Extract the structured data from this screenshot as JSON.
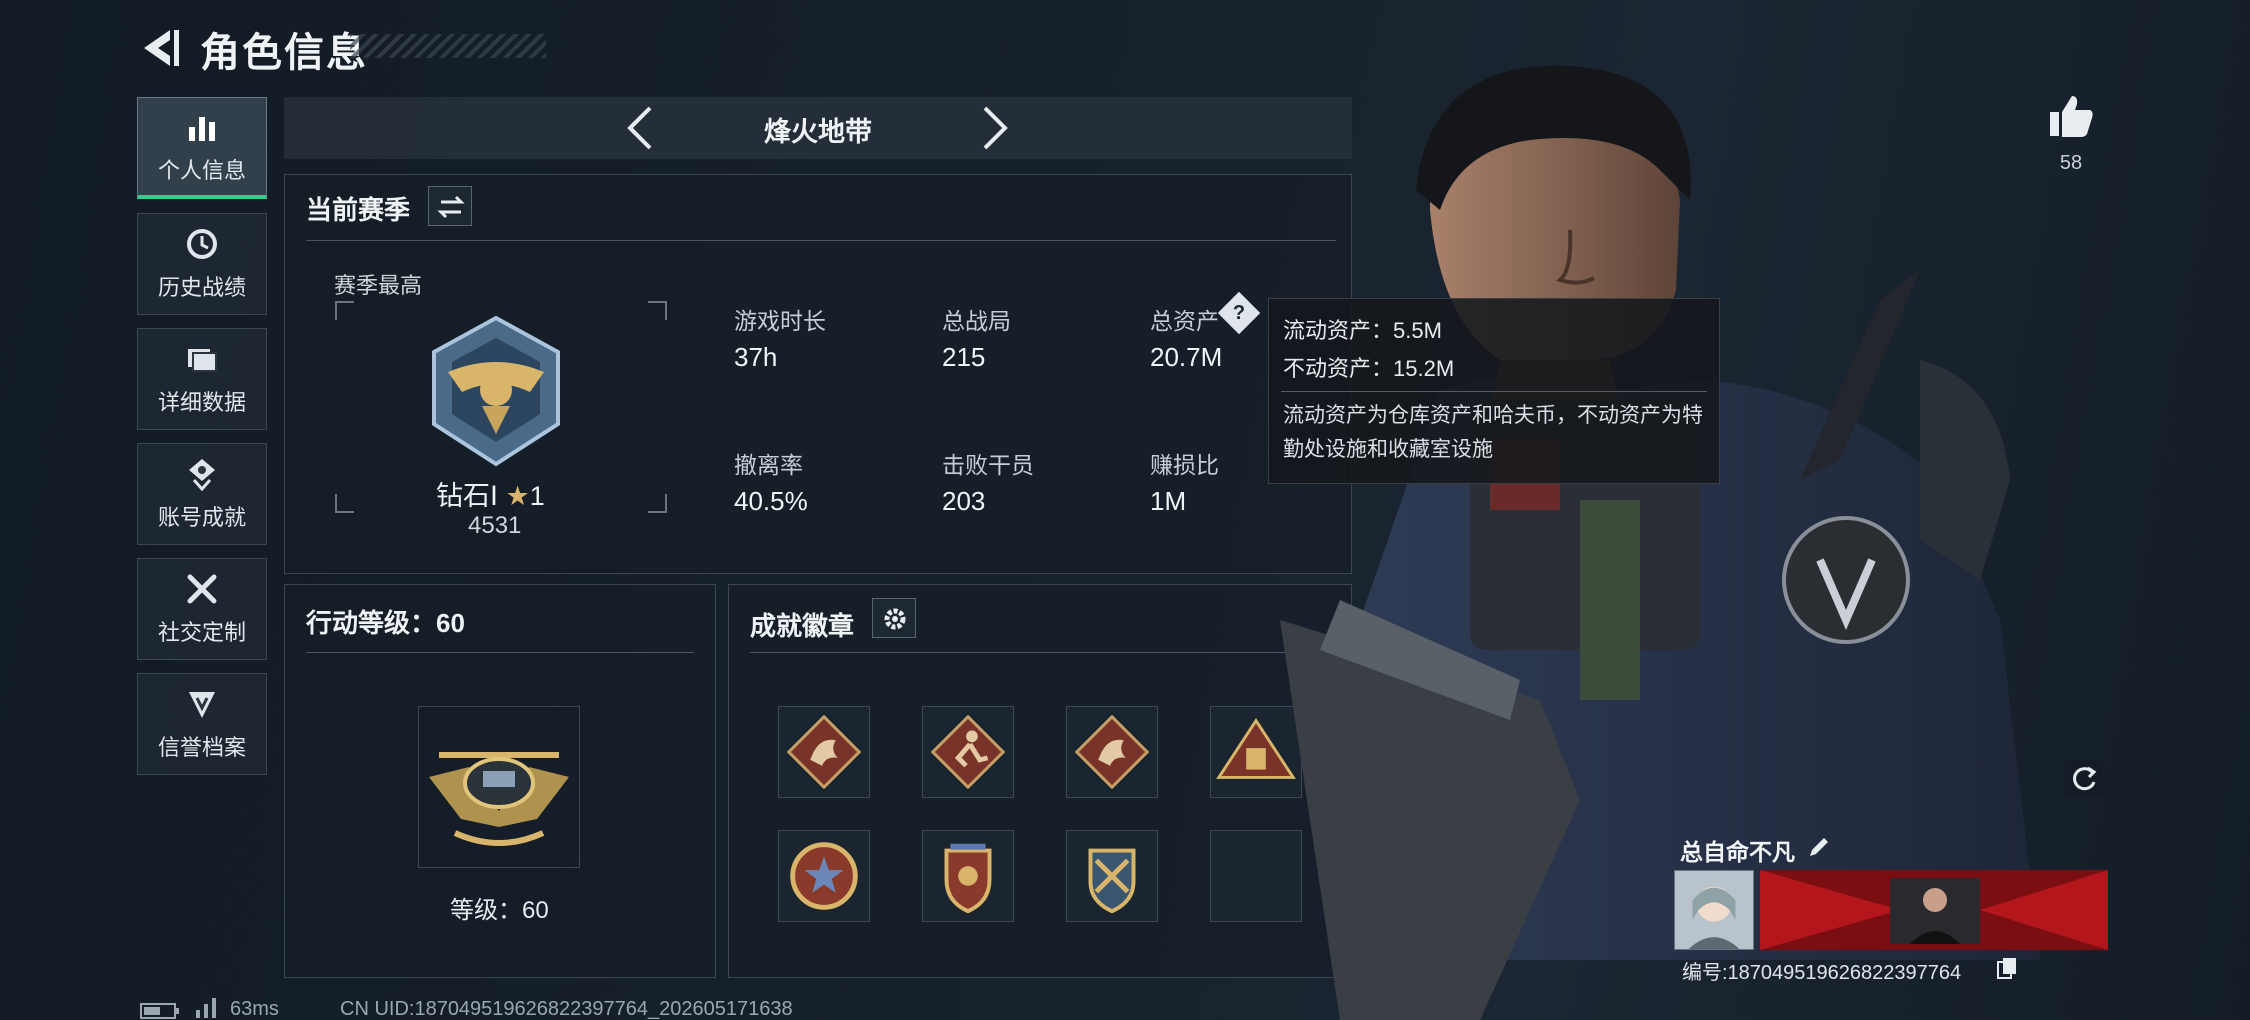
{
  "header": {
    "title": "角色信息"
  },
  "nav": {
    "items": [
      {
        "label": "个人信息",
        "icon": "bar-chart-icon",
        "active": true
      },
      {
        "label": "历史战绩",
        "icon": "history-icon",
        "active": false
      },
      {
        "label": "详细数据",
        "icon": "folder-icon",
        "active": false
      },
      {
        "label": "账号成就",
        "icon": "achievement-icon",
        "active": false
      },
      {
        "label": "社交定制",
        "icon": "tools-icon",
        "active": false
      },
      {
        "label": "信誉档案",
        "icon": "reputation-icon",
        "active": false
      }
    ]
  },
  "mode": {
    "title": "烽火地带"
  },
  "season": {
    "title": "当前赛季",
    "best_label": "赛季最高",
    "rank_name": "钻石Ⅰ",
    "rank_stars": "1",
    "rank_score": "4531",
    "stats": {
      "play_time_label": "游戏时长",
      "play_time_value": "37h",
      "matches_label": "总战局",
      "matches_value": "215",
      "assets_label": "总资产",
      "assets_value": "20.7M",
      "extract_label": "撤离率",
      "extract_value": "40.5%",
      "kills_label": "击败干员",
      "kills_value": "203",
      "profit_label": "赚损比",
      "profit_value": "1M"
    }
  },
  "tooltip": {
    "liquid": "流动资产：5.5M",
    "fixed": "不动资产：15.2M",
    "desc": "流动资产为仓库资产和哈夫币，不动资产为特勤处设施和收藏室设施"
  },
  "action_level": {
    "title": "行动等级：60",
    "level_text": "等级：60"
  },
  "badges": {
    "title": "成就徽章",
    "items": [
      "dragon-badge-icon",
      "runner-badge-icon",
      "dragon-badge-icon",
      "supply-badge-icon",
      "star-medal-icon",
      "shield-medal-icon",
      "crossed-guns-medal-icon",
      "empty-slot"
    ]
  },
  "player": {
    "name": "总自命不凡",
    "id_text": "编号:18704951962682239776​4",
    "likes": "58"
  },
  "status": {
    "ping": "63ms",
    "uid": "CN UID:18704951962682239776​4_202605171638"
  },
  "colors": {
    "accent": "#3ec98e",
    "gold": "#d8b56a",
    "badge_red": "#7a3328"
  }
}
